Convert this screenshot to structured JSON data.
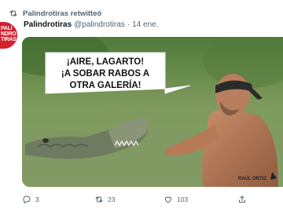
{
  "retweet": {
    "label": "Palindrotiras retwitteó"
  },
  "avatar": {
    "lines": [
      "PALÍ",
      "NDRO",
      "TIRAS"
    ]
  },
  "tweet": {
    "author_name": "Palindrotiras",
    "author_handle": "@palindrotiras",
    "separator": "·",
    "timestamp": "14 ene."
  },
  "image": {
    "speech": [
      "¡AIRE, LAGARTO!",
      "¡A SOBAR RABOS A",
      "OTRA GALERÍA!"
    ],
    "signature": "RAÚL ORTIZ"
  },
  "actions": {
    "reply_count": "3",
    "retweet_count": "23",
    "like_count": "103"
  },
  "colors": {
    "text_secondary": "#536471",
    "avatar_red": "#d3202f",
    "water": "#6f8a52"
  }
}
